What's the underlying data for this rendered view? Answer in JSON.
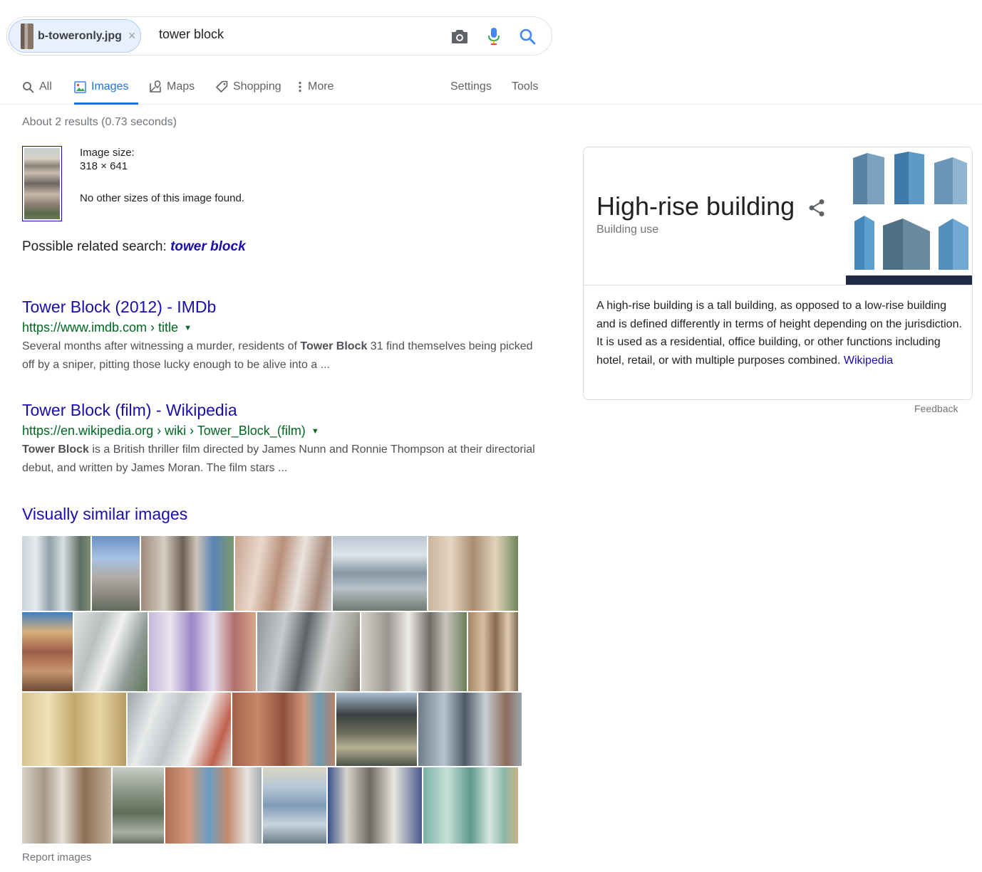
{
  "search": {
    "chip_label": "b-toweronly.jpg",
    "chip_close": "×",
    "query": "tower block"
  },
  "tabs": [
    {
      "label": "All",
      "icon": "search-icon"
    },
    {
      "label": "Images",
      "icon": "image-icon"
    },
    {
      "label": "Maps",
      "icon": "map-icon"
    },
    {
      "label": "Shopping",
      "icon": "tag-icon"
    },
    {
      "label": "More",
      "icon": "more-vert-icon"
    }
  ],
  "tools": {
    "settings": "Settings",
    "tools": "Tools"
  },
  "stats": "About 2 results (0.73 seconds)",
  "query_image": {
    "size_label": "Image size:",
    "size_value": "318 × 641",
    "note": "No other sizes of this image found."
  },
  "related": {
    "prefix": "Possible related search:",
    "term": "tower block"
  },
  "results": [
    {
      "title": "Tower Block (2012) - IMDb",
      "url": "https://www.imdb.com › title",
      "snippet_pre": "Several months after witnessing a murder, residents of ",
      "snippet_bold": "Tower Block",
      "snippet_post": " 31 find themselves being picked off by a sniper, pitting those lucky enough to be alive into a ..."
    },
    {
      "title": "Tower Block (film) - Wikipedia",
      "url": "https://en.wikipedia.org › wiki › Tower_Block_(film)",
      "snippet_pre": "",
      "snippet_bold": "Tower Block",
      "snippet_post": " is a British thriller film directed by James Nunn and Ronnie Thompson at their directorial debut, and written by James Moran. The film stars ..."
    }
  ],
  "similar": {
    "heading": "Visually similar images",
    "report": "Report images"
  },
  "knowledge_panel": {
    "title": "High-rise building",
    "subtitle": "Building use",
    "description": "A high-rise building is a tall building, as opposed to a low-rise building and is defined differently in terms of height depending on the jurisdiction. It is used as a residential, office building, or other functions including hotel, retail, or with multiple purposes combined.",
    "source": "Wikipedia",
    "feedback": "Feedback"
  },
  "colors": {
    "link": "#1a0dab",
    "url": "#006621",
    "accent": "#1a73e8",
    "muted": "#70757a"
  }
}
